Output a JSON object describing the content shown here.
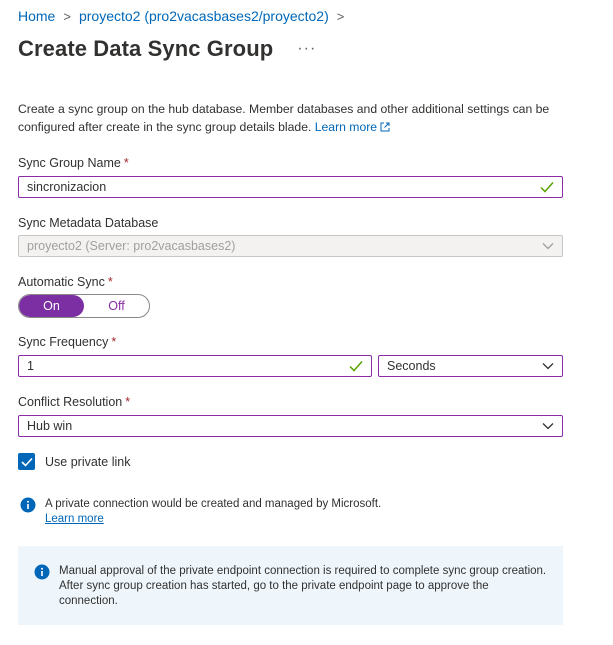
{
  "breadcrumb": {
    "items": [
      "Home",
      "proyecto2 (pro2vacasbases2/proyecto2)"
    ]
  },
  "header": {
    "title": "Create Data Sync Group",
    "more": "···"
  },
  "description": {
    "text": "Create a sync group on the hub database. Member databases and other additional settings can be configured after create in the sync group details blade.",
    "link": "Learn more"
  },
  "form": {
    "sync_group_name": {
      "label": "Sync Group Name",
      "required": "*",
      "value": "sincronizacion"
    },
    "metadata_db": {
      "label": "Sync Metadata Database",
      "value": "proyecto2 (Server: pro2vacasbases2)"
    },
    "automatic_sync": {
      "label": "Automatic Sync",
      "required": "*",
      "on": "On",
      "off": "Off",
      "selected": "On"
    },
    "sync_frequency": {
      "label": "Sync Frequency",
      "required": "*",
      "value": "1",
      "unit": "Seconds"
    },
    "conflict_resolution": {
      "label": "Conflict Resolution",
      "required": "*",
      "value": "Hub win"
    },
    "private_link": {
      "label": "Use private link",
      "checked": true
    }
  },
  "info": {
    "text": "A private connection would be created and managed by Microsoft.",
    "link": "Learn more"
  },
  "banner": {
    "text": "Manual approval of the private endpoint connection is required to complete sync group creation. After sync group creation has started, go to the private endpoint page to approve the connection."
  },
  "colors": {
    "accent": "#8a2da5",
    "toggle_on": "#7b2fa3",
    "link": "#0067b8",
    "valid_check": "#57a300",
    "info_banner": "#eef6fc"
  }
}
